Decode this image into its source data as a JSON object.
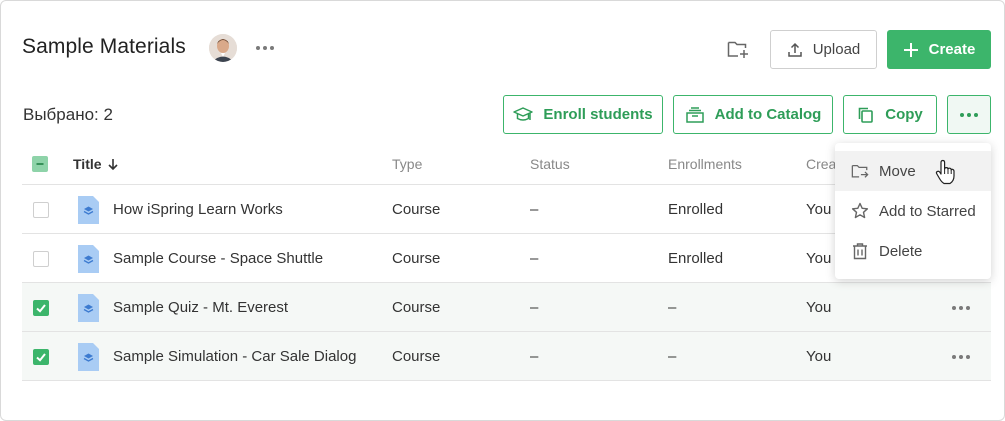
{
  "header": {
    "title": "Sample Materials",
    "upload_label": "Upload",
    "create_label": "Create"
  },
  "toolbar": {
    "selected_count": "Выбрано: 2",
    "enroll_label": "Enroll students",
    "catalog_label": "Add to Catalog",
    "copy_label": "Copy"
  },
  "table": {
    "columns": [
      "Title",
      "Type",
      "Status",
      "Enrollments",
      "Crea"
    ],
    "rows": [
      {
        "title": "How iSpring Learn Works",
        "type": "Course",
        "status": "–",
        "enrollments": "Enrolled",
        "created_by": "You",
        "checked": false
      },
      {
        "title": "Sample Course - Space Shuttle",
        "type": "Course",
        "status": "–",
        "enrollments": "Enrolled",
        "created_by": "You",
        "checked": false
      },
      {
        "title": "Sample Quiz - Mt. Everest",
        "type": "Course",
        "status": "–",
        "enrollments": "–",
        "created_by": "You",
        "checked": true
      },
      {
        "title": "Sample Simulation - Car Sale Dialog",
        "type": "Course",
        "status": "–",
        "enrollments": "–",
        "created_by": "You",
        "checked": true
      }
    ]
  },
  "menu": {
    "items": [
      {
        "label": "Move",
        "icon": "move-folder-icon"
      },
      {
        "label": "Add to Starred",
        "icon": "star-icon"
      },
      {
        "label": "Delete",
        "icon": "trash-icon"
      }
    ]
  },
  "colors": {
    "accent": "#3cb56b",
    "accent_text": "#2e9d58",
    "file_icon": "#a9ccf4"
  }
}
